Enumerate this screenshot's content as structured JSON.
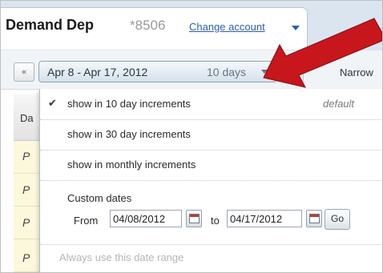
{
  "account": {
    "name": "Demand Dep",
    "number": "*8506",
    "change_link": "Change account"
  },
  "toolbar": {
    "prev_label": "«",
    "range_label": "Apr 8 - Apr 17, 2012",
    "range_days": "10 days",
    "narrow_label": "Narrow"
  },
  "table": {
    "header_text": "Da",
    "row_text": "P"
  },
  "dropdown": {
    "options": [
      {
        "label": "show in 10 day increments",
        "checked": true,
        "badge": "default"
      },
      {
        "label": "show in 30 day increments",
        "checked": false
      },
      {
        "label": "show in monthly increments",
        "checked": false
      }
    ],
    "check_glyph": "✔",
    "custom": {
      "title": "Custom dates",
      "from_label": "From",
      "from_value": "04/08/2012",
      "to_label": "to",
      "to_value": "04/17/2012",
      "go_label": "Go"
    },
    "always_label": "Always use this date range"
  },
  "colors": {
    "annotation_arrow": "#c8161d",
    "link": "#2a5db0"
  },
  "icons": [
    "calendar-icon",
    "dropdown-caret-icon",
    "check-icon",
    "annotation-arrow"
  ]
}
